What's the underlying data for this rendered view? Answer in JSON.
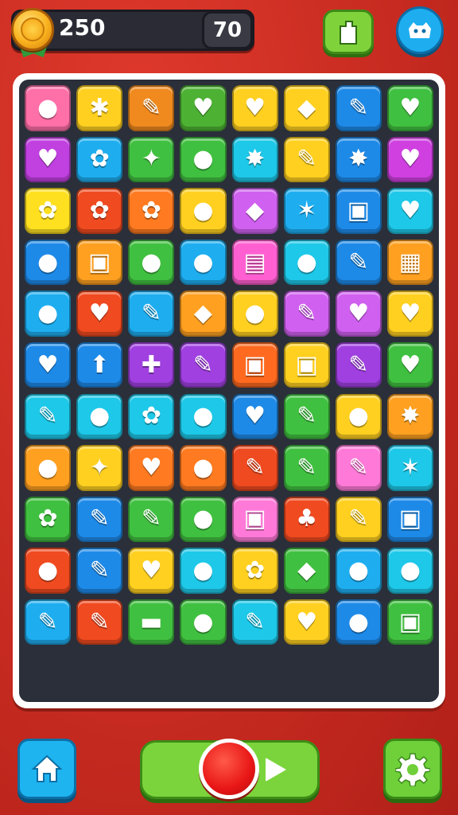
{
  "hud": {
    "coins": "250",
    "moves": "70"
  },
  "icons": {
    "coin": "gold-medal-icon",
    "shop": "shop-bag-icon",
    "pet": "pet-face-icon",
    "home": "home-icon",
    "record": "record-icon",
    "play": "play-icon",
    "settings": "gear-icon"
  },
  "colors": {
    "background": "#c62a20",
    "board_frame": "#ffffff",
    "board_inner": "#2a2f3a"
  },
  "board": {
    "columns": 8,
    "rows": 12,
    "tiles": [
      {
        "c": "#ff6fa8",
        "g": "●"
      },
      {
        "c": "#ffd020",
        "g": "✱"
      },
      {
        "c": "#f08a1e",
        "g": "✎"
      },
      {
        "c": "#4db233",
        "g": "♥"
      },
      {
        "c": "#ffd020",
        "g": "♥"
      },
      {
        "c": "#ffd020",
        "g": "◆"
      },
      {
        "c": "#1e8ae8",
        "g": "✎"
      },
      {
        "c": "#40c040",
        "g": "♥"
      },
      {
        "c": "#c040e0",
        "g": "♥"
      },
      {
        "c": "#1eaef0",
        "g": "✿"
      },
      {
        "c": "#40c040",
        "g": "✦"
      },
      {
        "c": "#40c040",
        "g": "●"
      },
      {
        "c": "#1ec8e8",
        "g": "✸"
      },
      {
        "c": "#ffd020",
        "g": "✎"
      },
      {
        "c": "#1e8ae8",
        "g": "✸"
      },
      {
        "c": "#d040e0",
        "g": "♥"
      },
      {
        "c": "#ffe020",
        "g": "✿"
      },
      {
        "c": "#f04a20",
        "g": "✿"
      },
      {
        "c": "#ff7a20",
        "g": "✿"
      },
      {
        "c": "#ffd020",
        "g": "●"
      },
      {
        "c": "#d060f0",
        "g": "◆"
      },
      {
        "c": "#1eaef0",
        "g": "✶"
      },
      {
        "c": "#1e8ae8",
        "g": "▣"
      },
      {
        "c": "#1ec8e8",
        "g": "♥"
      },
      {
        "c": "#1e8ae8",
        "g": "●"
      },
      {
        "c": "#ffa020",
        "g": "▣"
      },
      {
        "c": "#40c040",
        "g": "●"
      },
      {
        "c": "#1eaef0",
        "g": "●"
      },
      {
        "c": "#ff5fd0",
        "g": "▤"
      },
      {
        "c": "#1ec8e8",
        "g": "●"
      },
      {
        "c": "#1e8ae8",
        "g": "✎"
      },
      {
        "c": "#ffa020",
        "g": "▦"
      },
      {
        "c": "#1eaef0",
        "g": "●"
      },
      {
        "c": "#f04a20",
        "g": "♥"
      },
      {
        "c": "#1eaef0",
        "g": "✎"
      },
      {
        "c": "#ffa020",
        "g": "◆"
      },
      {
        "c": "#ffd020",
        "g": "●"
      },
      {
        "c": "#d060f0",
        "g": "✎"
      },
      {
        "c": "#d060f0",
        "g": "♥"
      },
      {
        "c": "#ffd020",
        "g": "♥"
      },
      {
        "c": "#1e8ae8",
        "g": "♥"
      },
      {
        "c": "#1e8ae8",
        "g": "⬆"
      },
      {
        "c": "#a040e0",
        "g": "✚"
      },
      {
        "c": "#a040e0",
        "g": "✎"
      },
      {
        "c": "#ff6a20",
        "g": "▣"
      },
      {
        "c": "#ffd020",
        "g": "▣"
      },
      {
        "c": "#a040e0",
        "g": "✎"
      },
      {
        "c": "#40c040",
        "g": "♥"
      },
      {
        "c": "#1ec8e8",
        "g": "✎"
      },
      {
        "c": "#1ec8e8",
        "g": "●"
      },
      {
        "c": "#1ec8e8",
        "g": "✿"
      },
      {
        "c": "#1ec8e8",
        "g": "●"
      },
      {
        "c": "#1e8ae8",
        "g": "♥"
      },
      {
        "c": "#40c040",
        "g": "✎"
      },
      {
        "c": "#ffd020",
        "g": "●"
      },
      {
        "c": "#ffa020",
        "g": "✸"
      },
      {
        "c": "#ffa020",
        "g": "●"
      },
      {
        "c": "#ffd020",
        "g": "✦"
      },
      {
        "c": "#ff7a20",
        "g": "♥"
      },
      {
        "c": "#ff7a20",
        "g": "●"
      },
      {
        "c": "#f04a20",
        "g": "✎"
      },
      {
        "c": "#40c040",
        "g": "✎"
      },
      {
        "c": "#ff7ad8",
        "g": "✎"
      },
      {
        "c": "#1ec8e8",
        "g": "✶"
      },
      {
        "c": "#40c040",
        "g": "✿"
      },
      {
        "c": "#1e8ae8",
        "g": "✎"
      },
      {
        "c": "#40c040",
        "g": "✎"
      },
      {
        "c": "#40c040",
        "g": "●"
      },
      {
        "c": "#ff7ad8",
        "g": "▣"
      },
      {
        "c": "#f04a20",
        "g": "♣"
      },
      {
        "c": "#ffd020",
        "g": "✎"
      },
      {
        "c": "#1e8ae8",
        "g": "▣"
      },
      {
        "c": "#f04a20",
        "g": "●"
      },
      {
        "c": "#1e8ae8",
        "g": "✎"
      },
      {
        "c": "#ffd020",
        "g": "♥"
      },
      {
        "c": "#1ec8e8",
        "g": "●"
      },
      {
        "c": "#ffd020",
        "g": "✿"
      },
      {
        "c": "#40c040",
        "g": "◆"
      },
      {
        "c": "#1eaef0",
        "g": "●"
      },
      {
        "c": "#1ec8e8",
        "g": "●"
      },
      {
        "c": "#1eaef0",
        "g": "✎"
      },
      {
        "c": "#f04a20",
        "g": "✎"
      },
      {
        "c": "#40c040",
        "g": "▬"
      },
      {
        "c": "#40c040",
        "g": "●"
      },
      {
        "c": "#1ec8e8",
        "g": "✎"
      },
      {
        "c": "#ffd020",
        "g": "♥"
      },
      {
        "c": "#1e8ae8",
        "g": "●"
      },
      {
        "c": "#40c040",
        "g": "▣"
      }
    ]
  }
}
